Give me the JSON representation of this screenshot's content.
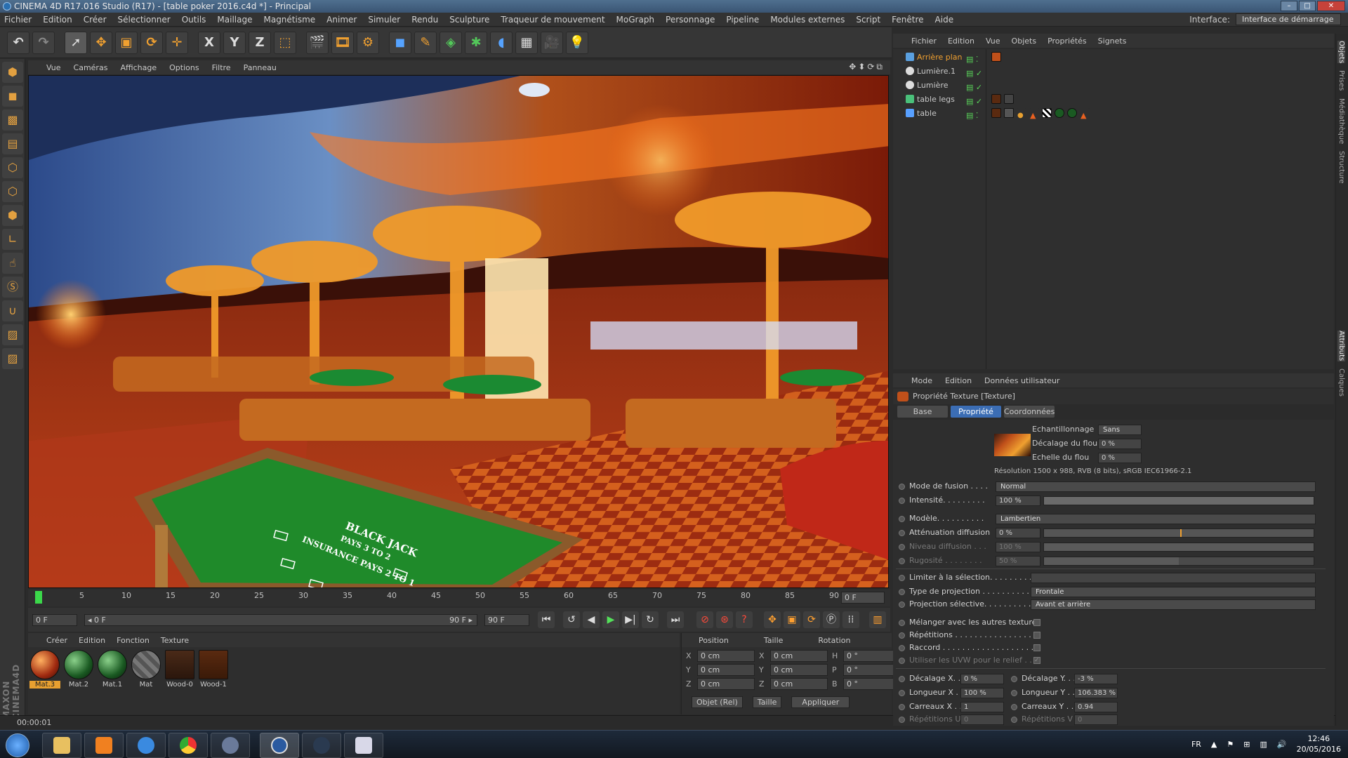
{
  "window": {
    "title": "CINEMA 4D R17.016 Studio (R17) - [table poker 2016.c4d *] - Principal",
    "buttons": [
      "–",
      "□",
      "✕"
    ]
  },
  "menubar": {
    "items": [
      "Fichier",
      "Edition",
      "Créer",
      "Sélectionner",
      "Outils",
      "Maillage",
      "Magnétisme",
      "Animer",
      "Simuler",
      "Rendu",
      "Sculpture",
      "Traqueur de mouvement",
      "MoGraph",
      "Personnage",
      "Pipeline",
      "Modules externes",
      "Script",
      "Fenêtre",
      "Aide"
    ],
    "interface_label": "Interface:",
    "interface_value": "Interface de démarrage"
  },
  "toolbar": {
    "letters": {
      "x": "X",
      "y": "Y",
      "z": "Z"
    }
  },
  "viewport": {
    "menu": [
      "Vue",
      "Caméras",
      "Affichage",
      "Options",
      "Filtre",
      "Panneau"
    ],
    "table_text": {
      "line1": "BLACK JACK",
      "line2": "PAYS 3 TO 2",
      "line3": "INSURANCE PAYS 2 TO 1"
    }
  },
  "timeline": {
    "ticks": [
      "0",
      "5",
      "10",
      "15",
      "20",
      "25",
      "30",
      "35",
      "40",
      "45",
      "50",
      "55",
      "60",
      "65",
      "70",
      "75",
      "80",
      "85",
      "90"
    ],
    "end_label": "0 F",
    "current_frame": "0 F",
    "range_start": "◂ 0 F",
    "range_end": "90 F ▸",
    "max_frame": "90 F"
  },
  "materials": {
    "menu": [
      "Créer",
      "Edition",
      "Fonction",
      "Texture"
    ],
    "items": [
      {
        "name": "Mat.3"
      },
      {
        "name": "Mat.2"
      },
      {
        "name": "Mat.1"
      },
      {
        "name": "Mat"
      },
      {
        "name": "Wood-0"
      },
      {
        "name": "Wood-1"
      }
    ]
  },
  "coordinates": {
    "headers": [
      "Position",
      "Taille",
      "Rotation"
    ],
    "rows": [
      {
        "axis": "X",
        "pos": "0 cm",
        "size_axis": "X",
        "size": "0 cm",
        "rot_axis": "H",
        "rot": "0 °"
      },
      {
        "axis": "Y",
        "pos": "0 cm",
        "size_axis": "Y",
        "size": "0 cm",
        "rot_axis": "P",
        "rot": "0 °"
      },
      {
        "axis": "Z",
        "pos": "0 cm",
        "size_axis": "Z",
        "size": "0 cm",
        "rot_axis": "B",
        "rot": "0 °"
      }
    ],
    "mode": "Objet (Rel)",
    "size_mode": "Taille",
    "apply": "Appliquer"
  },
  "status": {
    "time": "00:00:01"
  },
  "object_manager": {
    "menu": [
      "Fichier",
      "Edition",
      "Vue",
      "Objets",
      "Propriétés",
      "Signets"
    ],
    "objects": [
      {
        "name": "Arrière plan",
        "highlight": true
      },
      {
        "name": "Lumière.1",
        "highlight": false
      },
      {
        "name": "Lumière",
        "highlight": false
      },
      {
        "name": "table legs",
        "highlight": false
      },
      {
        "name": "table",
        "highlight": false
      }
    ]
  },
  "attributes": {
    "menu": [
      "Mode",
      "Edition",
      "Données utilisateur"
    ],
    "title": "Propriété Texture [Texture]",
    "tabs": [
      "Base",
      "Propriété",
      "Coordonnées"
    ],
    "active_tab": "Propriété",
    "sampling_label": "Echantillonnage",
    "sampling_value": "Sans",
    "blur_offset_label": "Décalage du flou",
    "blur_offset_value": "0 %",
    "blur_scale_label": "Echelle du flou",
    "blur_scale_value": "0 %",
    "resolution": "Résolution 1500 x 988, RVB (8 bits), sRGB IEC61966-2.1",
    "fusion_label": "Mode de fusion . . . .",
    "fusion_value": "Normal",
    "intensity_label": "Intensité. . . . . . . . .",
    "intensity_value": "100 %",
    "intensity": 1.0,
    "model_label": "Modèle. . . . . . . . . .",
    "model_value": "Lambertien",
    "diffusion_att_label": "Atténuation diffusion",
    "diffusion_att_value": "0 %",
    "diffusion_lvl_label": "Niveau diffusion . . .",
    "diffusion_lvl_value": "100 %",
    "roughness_label": "Rugosité . . . . . . . .",
    "roughness_value": "50 %",
    "roughness": 0.5,
    "limit_label": "Limiter à la sélection. . . . . . . . . . .",
    "projection_label": "Type de projection . . . . . . . . . . . .",
    "projection_value": "Frontale",
    "sel_projection_label": "Projection sélective. . . . . . . . . . .",
    "sel_projection_value": "Avant et arrière",
    "mix_label": "Mélanger avec les autres textures",
    "repeat_label": "Répétitions . . . . . . . . . . . . . . . . . .",
    "seam_label": "Raccord . . . . . . . . . . . . . . . . . . . .",
    "uvw_label": "Utiliser les UVW pour le relief . . .",
    "offset_x_label": "Décalage X. .",
    "offset_x_value": "0 %",
    "offset_y_label": "Décalage Y. . .",
    "offset_y_value": "-3 %",
    "length_x_label": "Longueur X . .",
    "length_x_value": "100 %",
    "length_y_label": "Longueur Y . .",
    "length_y_value": "106.383 %",
    "tiles_x_label": "Carreaux X . .",
    "tiles_x_value": "1",
    "tiles_y_label": "Carreaux Y . .",
    "tiles_y_value": "0.94",
    "rep_u_label": "Répétitions U",
    "rep_u_value": "0",
    "rep_v_label": "Répétitions V",
    "rep_v_value": "0"
  },
  "right_tabs": [
    "Objets",
    "Prises",
    "Médiathèque",
    "Structure"
  ],
  "right_tabs_lower": [
    "Attributs",
    "Calques"
  ],
  "taskbar": {
    "lang": "FR",
    "time": "12:46",
    "date": "20/05/2016"
  },
  "colors": {
    "accent": "#e8a030",
    "felt": "#1f8a2a",
    "selected_tab": "#3b6db4"
  }
}
